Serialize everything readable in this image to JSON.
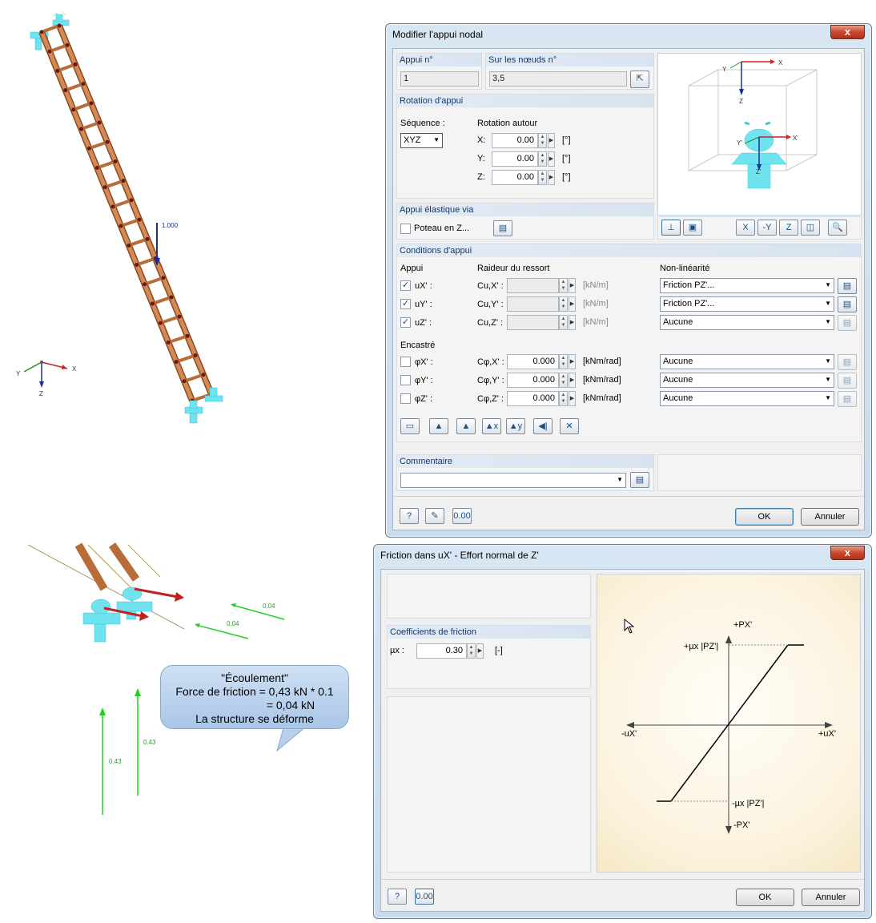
{
  "left_top": {
    "load_label": "1.000",
    "axes": {
      "x": "X",
      "y": "Y",
      "z": "Z"
    }
  },
  "left_bottom": {
    "labels": {
      "r1": "0.04",
      "r2": "0.04",
      "v1": "0.43",
      "v2": "0.43"
    },
    "callout": {
      "l1": "\"Écoulement\"",
      "l2": "Force de friction = 0,43 kN * 0.1",
      "l3": "= 0,04 kN",
      "l4": "La structure se déforme"
    }
  },
  "dialog1": {
    "title": "Modifier l'appui nodal",
    "close": "x",
    "appui_no": {
      "header": "Appui n°",
      "value": "1"
    },
    "nodes": {
      "header": "Sur les nœuds n°",
      "value": "3,5"
    },
    "rotation": {
      "header": "Rotation d'appui",
      "seq_label": "Séquence :",
      "seq_value": "XYZ",
      "around_label": "Rotation autour",
      "rows": [
        {
          "axis": "X:",
          "value": "0.00",
          "unit": "[°]"
        },
        {
          "axis": "Y:",
          "value": "0.00",
          "unit": "[°]"
        },
        {
          "axis": "Z:",
          "value": "0.00",
          "unit": "[°]"
        }
      ]
    },
    "elastic": {
      "header": "Appui élastique via",
      "checkbox": "Poteau en Z..."
    },
    "preview": {
      "axes": {
        "x": "X",
        "y": "Y",
        "z": "Z",
        "xp": "X'",
        "yp": "Y'",
        "zp": "Z'"
      }
    },
    "conditions": {
      "header": "Conditions d'appui",
      "col_appui": "Appui",
      "col_raideur": "Raideur du ressort",
      "col_nonlin": "Non-linéarité",
      "encastre": "Encastré",
      "rows": [
        {
          "dof": "uX' :",
          "checked": "✓",
          "spring": "Cu,X' :",
          "value": "",
          "unit": "[kN/m]",
          "nonlin": "Friction PZ'..."
        },
        {
          "dof": "uY' :",
          "checked": "✓",
          "spring": "Cu,Y' :",
          "value": "",
          "unit": "[kN/m]",
          "nonlin": "Friction PZ'..."
        },
        {
          "dof": "uZ' :",
          "checked": "✓",
          "spring": "Cu,Z' :",
          "value": "",
          "unit": "[kN/m]",
          "nonlin": "Aucune"
        },
        {
          "dof": "φX' :",
          "checked": "",
          "spring": "Cφ,X' :",
          "value": "0.000",
          "unit": "[kNm/rad]",
          "nonlin": "Aucune"
        },
        {
          "dof": "φY' :",
          "checked": "",
          "spring": "Cφ,Y' :",
          "value": "0.000",
          "unit": "[kNm/rad]",
          "nonlin": "Aucune"
        },
        {
          "dof": "φZ' :",
          "checked": "",
          "spring": "Cφ,Z' :",
          "value": "0.000",
          "unit": "[kNm/rad]",
          "nonlin": "Aucune"
        }
      ]
    },
    "comment": {
      "header": "Commentaire",
      "value": ""
    },
    "footer": {
      "ok": "OK",
      "cancel": "Annuler"
    }
  },
  "dialog2": {
    "title": "Friction dans uX' - Effort normal de Z'",
    "close": "x",
    "coef": {
      "header": "Coefficients de friction",
      "label": "µx :",
      "value": "0.30",
      "unit": "[-]"
    },
    "diagram": {
      "py_pos": "+PX'",
      "py_neg": "-PX'",
      "ux_pos": "+uX'",
      "ux_neg": "-uX'",
      "mu_pos": "+µx |PZ'|",
      "mu_neg": "-µx |PZ'|"
    },
    "footer": {
      "ok": "OK",
      "cancel": "Annuler"
    }
  }
}
